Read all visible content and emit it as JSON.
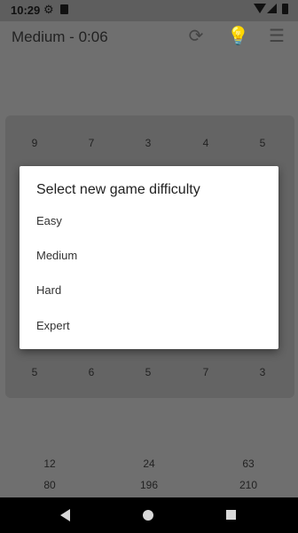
{
  "status_bar": {
    "time": "10:29"
  },
  "app_bar": {
    "title": "Medium - 0:06"
  },
  "board": {
    "top_row": [
      "9",
      "7",
      "3",
      "4",
      "5"
    ],
    "bottom_row": [
      "5",
      "6",
      "5",
      "7",
      "3"
    ]
  },
  "scores": {
    "row1": [
      "12",
      "24",
      "63"
    ],
    "row2": [
      "80",
      "196",
      "210"
    ]
  },
  "dialog": {
    "title": "Select new game difficulty",
    "options": [
      "Easy",
      "Medium",
      "Hard",
      "Expert"
    ]
  }
}
